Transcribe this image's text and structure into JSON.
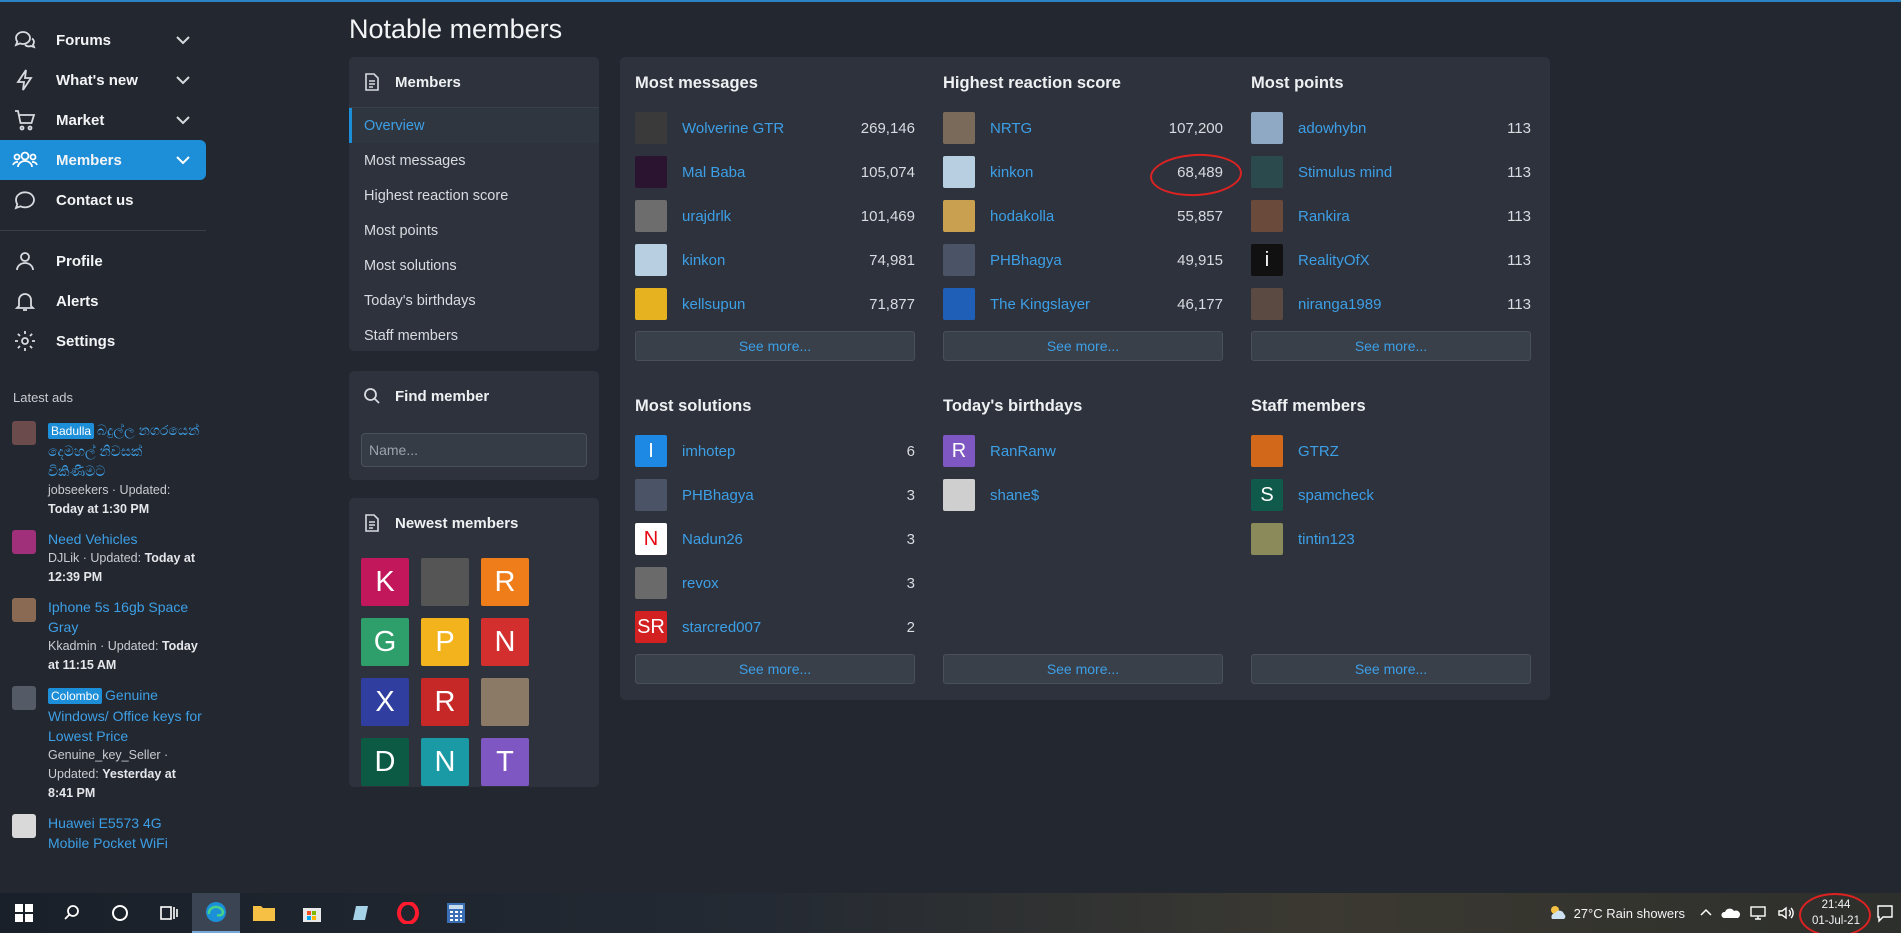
{
  "sidebar": {
    "nav": [
      {
        "label": "Forums",
        "icon": "forums-icon",
        "chevron": true
      },
      {
        "label": "What's new",
        "icon": "bolt-icon",
        "chevron": true
      },
      {
        "label": "Market",
        "icon": "cart-icon",
        "chevron": true
      },
      {
        "label": "Members",
        "icon": "members-icon",
        "chevron": true,
        "active": true
      },
      {
        "label": "Contact us",
        "icon": "chat-icon",
        "chevron": false
      }
    ],
    "account": [
      {
        "label": "Profile",
        "icon": "user-icon"
      },
      {
        "label": "Alerts",
        "icon": "bell-icon"
      },
      {
        "label": "Settings",
        "icon": "gear-icon"
      }
    ],
    "latest_title": "Latest ads",
    "ads": [
      {
        "tag": "Badulla",
        "title": "බදුල්ල නගරයෙන් දෙමහල් නිවසක් විකිණීමට",
        "meta": "jobseekers · Updated: ",
        "when": "Today at 1:30 PM",
        "thumb": "#6b4b4b"
      },
      {
        "tag": "",
        "title": "Need Vehicles",
        "meta": "DJLik · Updated: ",
        "when": "Today at 12:39 PM",
        "thumb": "#a0307a"
      },
      {
        "tag": "",
        "title": "Iphone 5s 16gb Space Gray",
        "meta": "Kkadmin · Updated: ",
        "when": "Today at 11:15 AM",
        "thumb": "#8a6a52"
      },
      {
        "tag": "Colombo",
        "title": "Genuine Windows/ Office keys for Lowest Price",
        "meta": "Genuine_key_Seller · Updated: ",
        "when": "Yesterday at 8:41 PM",
        "thumb": "#555b66"
      },
      {
        "tag": "",
        "title": "Huawei E5573 4G Mobile Pocket WiFi",
        "meta": "",
        "when": "",
        "thumb": "#d9d9d9"
      }
    ]
  },
  "page_title": "Notable members",
  "members_card": {
    "title": "Members",
    "items": [
      "Overview",
      "Most messages",
      "Highest reaction score",
      "Most points",
      "Most solutions",
      "Today's birthdays",
      "Staff members"
    ]
  },
  "find_card": {
    "title": "Find member",
    "placeholder": "Name..."
  },
  "newest_card": {
    "title": "Newest members",
    "avatars": [
      {
        "letter": "K",
        "color": "#c2185b"
      },
      {
        "letter": "",
        "color": "#555555"
      },
      {
        "letter": "R",
        "color": "#ef7d1a"
      },
      {
        "letter": "G",
        "color": "#2e9e6a"
      },
      {
        "letter": "P",
        "color": "#f3b31c"
      },
      {
        "letter": "N",
        "color": "#d32f2f"
      },
      {
        "letter": "X",
        "color": "#303f9f"
      },
      {
        "letter": "R",
        "color": "#c62828"
      },
      {
        "letter": "",
        "color": "#8a7a66"
      },
      {
        "letter": "D",
        "color": "#0c5a44"
      },
      {
        "letter": "N",
        "color": "#1a9aa5"
      },
      {
        "letter": "T",
        "color": "#7e57c2"
      }
    ]
  },
  "blocks": [
    {
      "title": "Most messages",
      "see_more": "See more...",
      "rows": [
        {
          "name": "Wolverine GTR",
          "value": "269,146",
          "av": "#3a3a3a",
          "letter": ""
        },
        {
          "name": "Mal Baba",
          "value": "105,074",
          "av": "#2a1430",
          "letter": ""
        },
        {
          "name": "urajdrlk",
          "value": "101,469",
          "av": "#6d6d6d",
          "letter": ""
        },
        {
          "name": "kinkon",
          "value": "74,981",
          "av": "#b7cfe0",
          "letter": ""
        },
        {
          "name": "kellsupun",
          "value": "71,877",
          "av": "#e7b220",
          "letter": ""
        }
      ]
    },
    {
      "title": "Highest reaction score",
      "see_more": "See more...",
      "rows": [
        {
          "name": "NRTG",
          "value": "107,200",
          "av": "#7a6a5a",
          "letter": ""
        },
        {
          "name": "kinkon",
          "value": "68,489",
          "av": "#b7cfe0",
          "letter": ""
        },
        {
          "name": "hodakolla",
          "value": "55,857",
          "av": "#c9a050",
          "letter": ""
        },
        {
          "name": "PHBhagya",
          "value": "49,915",
          "av": "#4a5466",
          "letter": ""
        },
        {
          "name": "The Kingslayer",
          "value": "46,177",
          "av": "#1f5fb8",
          "letter": ""
        }
      ]
    },
    {
      "title": "Most points",
      "see_more": "See more...",
      "rows": [
        {
          "name": "adowhybn",
          "value": "113",
          "av": "#8fa9c4",
          "letter": ""
        },
        {
          "name": "Stimulus mind",
          "value": "113",
          "av": "#2b4a4e",
          "letter": ""
        },
        {
          "name": "Rankira",
          "value": "113",
          "av": "#6a4a3a",
          "letter": ""
        },
        {
          "name": "RealityOfX",
          "value": "113",
          "av": "#111111",
          "letter": "i"
        },
        {
          "name": "niranga1989",
          "value": "113",
          "av": "#5a4a42",
          "letter": ""
        }
      ]
    },
    {
      "title": "Most solutions",
      "see_more": "See more...",
      "rows": [
        {
          "name": "imhotep",
          "value": "6",
          "av": "#1e88e5",
          "letter": "I"
        },
        {
          "name": "PHBhagya",
          "value": "3",
          "av": "#4a5466",
          "letter": ""
        },
        {
          "name": "Nadun26",
          "value": "3",
          "av": "#ffffff",
          "letter": "N"
        },
        {
          "name": "revox",
          "value": "3",
          "av": "#6a6a6a",
          "letter": ""
        },
        {
          "name": "starcred007",
          "value": "2",
          "av": "#d32020",
          "letter": "SR"
        }
      ]
    },
    {
      "title": "Today's birthdays",
      "see_more": "See more...",
      "rows": [
        {
          "name": "RanRanw",
          "value": "",
          "av": "#7e57c2",
          "letter": "R"
        },
        {
          "name": "shane$",
          "value": "",
          "av": "#cfcfcf",
          "letter": ""
        }
      ]
    },
    {
      "title": "Staff members",
      "see_more": "See more...",
      "rows": [
        {
          "name": "GTRZ",
          "value": "",
          "av": "#d2681a",
          "letter": ""
        },
        {
          "name": "spamcheck",
          "value": "",
          "av": "#0f5a4a",
          "letter": "S"
        },
        {
          "name": "tintin123",
          "value": "",
          "av": "#8a8a5a",
          "letter": ""
        }
      ]
    }
  ],
  "taskbar": {
    "weather": "27°C  Rain showers",
    "time": "21:44",
    "date": "01-Jul-21"
  }
}
